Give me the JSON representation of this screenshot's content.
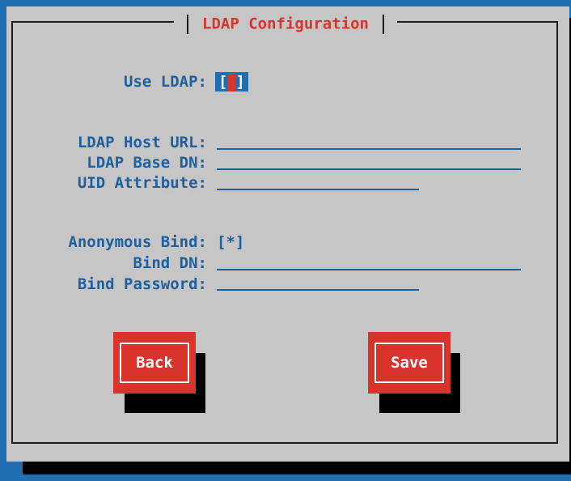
{
  "dialog": {
    "title": "LDAP Configuration"
  },
  "use_ldap": {
    "label": "Use LDAP:",
    "checked": false,
    "open": "[",
    "close": "]"
  },
  "server": {
    "host_url_label": "LDAP Host URL:",
    "host_url_value": "",
    "base_dn_label": "LDAP Base DN:",
    "base_dn_value": "",
    "uid_attr_label": "UID Attribute:",
    "uid_attr_value": ""
  },
  "bind": {
    "anonymous_label": "Anonymous Bind:",
    "anonymous_value": "[*]",
    "bind_dn_label": "Bind DN:",
    "bind_dn_value": "",
    "password_label": "Bind Password:",
    "password_value": ""
  },
  "buttons": {
    "back_label": "Back",
    "save_label": "Save"
  },
  "colors": {
    "background": "#1f6fb2",
    "dialog": "#c6c6c6",
    "accent": "#d8342b",
    "label": "#1f5f9e"
  }
}
